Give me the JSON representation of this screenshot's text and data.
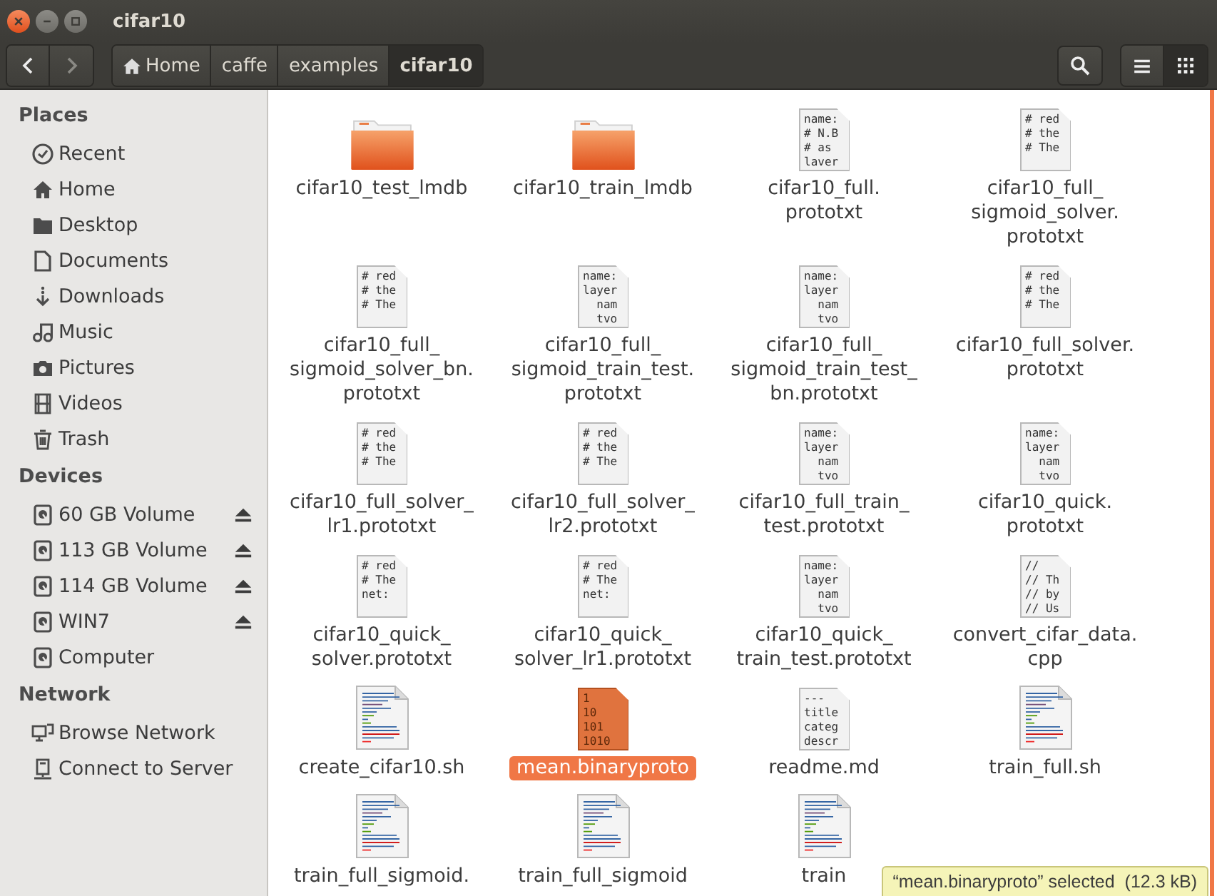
{
  "window": {
    "title": "cifar10"
  },
  "nav": [
    {
      "kind": "back",
      "disabled": false
    },
    {
      "kind": "forward",
      "disabled": true
    }
  ],
  "path": [
    {
      "label": "Home",
      "kind": "home",
      "selected": false
    },
    {
      "label": "caffe",
      "kind": "folder",
      "selected": false
    },
    {
      "label": "examples",
      "kind": "folder",
      "selected": false
    },
    {
      "label": "cifar10",
      "kind": "folder",
      "selected": true
    }
  ],
  "view_modes": [
    {
      "kind": "list",
      "selected": false
    },
    {
      "kind": "grid",
      "selected": true
    }
  ],
  "sidebar": [
    {
      "title": "Places",
      "items": [
        {
          "label": "Recent",
          "kind": "clock",
          "ejectable": false
        },
        {
          "label": "Home",
          "kind": "home",
          "ejectable": false
        },
        {
          "label": "Desktop",
          "kind": "folder",
          "ejectable": false
        },
        {
          "label": "Documents",
          "kind": "document",
          "ejectable": false
        },
        {
          "label": "Downloads",
          "kind": "download",
          "ejectable": false
        },
        {
          "label": "Music",
          "kind": "music",
          "ejectable": false
        },
        {
          "label": "Pictures",
          "kind": "camera",
          "ejectable": false
        },
        {
          "label": "Videos",
          "kind": "film",
          "ejectable": false
        },
        {
          "label": "Trash",
          "kind": "trash",
          "ejectable": false
        }
      ]
    },
    {
      "title": "Devices",
      "items": [
        {
          "label": "60 GB Volume",
          "kind": "drive",
          "ejectable": true
        },
        {
          "label": "113 GB Volume",
          "kind": "drive",
          "ejectable": true
        },
        {
          "label": "114 GB Volume",
          "kind": "drive",
          "ejectable": true
        },
        {
          "label": "WIN7",
          "kind": "drive",
          "ejectable": true
        },
        {
          "label": "Computer",
          "kind": "drive",
          "ejectable": false
        }
      ]
    },
    {
      "title": "Network",
      "items": [
        {
          "label": "Browse Network",
          "kind": "network",
          "ejectable": false
        },
        {
          "label": "Connect to Server",
          "kind": "server",
          "ejectable": false
        }
      ]
    }
  ],
  "files": [
    {
      "kind": "folder",
      "label_lines": [
        "cifar10_test_lmdb"
      ],
      "selected": false
    },
    {
      "kind": "folder",
      "label_lines": [
        "cifar10_train_lmdb"
      ],
      "selected": false
    },
    {
      "kind": "text",
      "preview": [
        "name:",
        "# N.B",
        "# as",
        "laver"
      ],
      "label_lines": [
        "cifar10_full.",
        "prototxt"
      ],
      "selected": false
    },
    {
      "kind": "text",
      "preview": [
        "# red",
        "# the",
        "# The"
      ],
      "label_lines": [
        "cifar10_full_",
        "sigmoid_solver.",
        "prototxt"
      ],
      "selected": false
    },
    {
      "kind": "text",
      "preview": [
        "# red",
        "# the",
        "# The"
      ],
      "label_lines": [
        "cifar10_full_",
        "sigmoid_solver_bn.",
        "prototxt"
      ],
      "selected": false
    },
    {
      "kind": "text",
      "preview": [
        "name:",
        "layer",
        "  nam",
        "  tvo"
      ],
      "label_lines": [
        "cifar10_full_",
        "sigmoid_train_test.",
        "prototxt"
      ],
      "selected": false
    },
    {
      "kind": "text",
      "preview": [
        "name:",
        "layer",
        "  nam",
        "  tvo"
      ],
      "label_lines": [
        "cifar10_full_",
        "sigmoid_train_test_",
        "bn.prototxt"
      ],
      "selected": false
    },
    {
      "kind": "text",
      "preview": [
        "# red",
        "# the",
        "# The"
      ],
      "label_lines": [
        "cifar10_full_solver.",
        "prototxt"
      ],
      "selected": false
    },
    {
      "kind": "text",
      "preview": [
        "# red",
        "# the",
        "# The"
      ],
      "label_lines": [
        "cifar10_full_solver_",
        "lr1.prototxt"
      ],
      "selected": false
    },
    {
      "kind": "text",
      "preview": [
        "# red",
        "# the",
        "# The"
      ],
      "label_lines": [
        "cifar10_full_solver_",
        "lr2.prototxt"
      ],
      "selected": false
    },
    {
      "kind": "text",
      "preview": [
        "name:",
        "layer",
        "  nam",
        "  tvo"
      ],
      "label_lines": [
        "cifar10_full_train_",
        "test.prototxt"
      ],
      "selected": false
    },
    {
      "kind": "text",
      "preview": [
        "name:",
        "layer",
        "  nam",
        "  tvo"
      ],
      "label_lines": [
        "cifar10_quick.",
        "prototxt"
      ],
      "selected": false
    },
    {
      "kind": "text",
      "preview": [
        "# red",
        "# The",
        "net:"
      ],
      "label_lines": [
        "cifar10_quick_",
        "solver.prototxt"
      ],
      "selected": false
    },
    {
      "kind": "text",
      "preview": [
        "# red",
        "# The",
        "net:"
      ],
      "label_lines": [
        "cifar10_quick_",
        "solver_lr1.prototxt"
      ],
      "selected": false
    },
    {
      "kind": "text",
      "preview": [
        "name:",
        "layer",
        "  nam",
        "  tvo"
      ],
      "label_lines": [
        "cifar10_quick_",
        "train_test.prototxt"
      ],
      "selected": false
    },
    {
      "kind": "text",
      "preview": [
        "//",
        "// Th",
        "// by",
        "// Us"
      ],
      "label_lines": [
        "convert_cifar_data.",
        "cpp"
      ],
      "selected": false
    },
    {
      "kind": "script",
      "label_lines": [
        "create_cifar10.sh"
      ],
      "selected": false
    },
    {
      "kind": "binary",
      "preview": [
        "1",
        "10",
        "101",
        "1010"
      ],
      "label_lines": [
        "mean.binaryproto"
      ],
      "selected": true
    },
    {
      "kind": "text",
      "preview": [
        "---",
        "title",
        "categ",
        "descr"
      ],
      "label_lines": [
        "readme.md"
      ],
      "selected": false
    },
    {
      "kind": "script",
      "label_lines": [
        "train_full.sh"
      ],
      "selected": false
    },
    {
      "kind": "script",
      "label_lines": [
        "train_full_sigmoid."
      ],
      "selected": false
    },
    {
      "kind": "script",
      "label_lines": [
        "train_full_sigmoid"
      ],
      "selected": false
    },
    {
      "kind": "script",
      "label_lines": [
        "train"
      ],
      "selected": false
    }
  ],
  "status": "“mean.binaryproto” selected  (12.3 kB)"
}
